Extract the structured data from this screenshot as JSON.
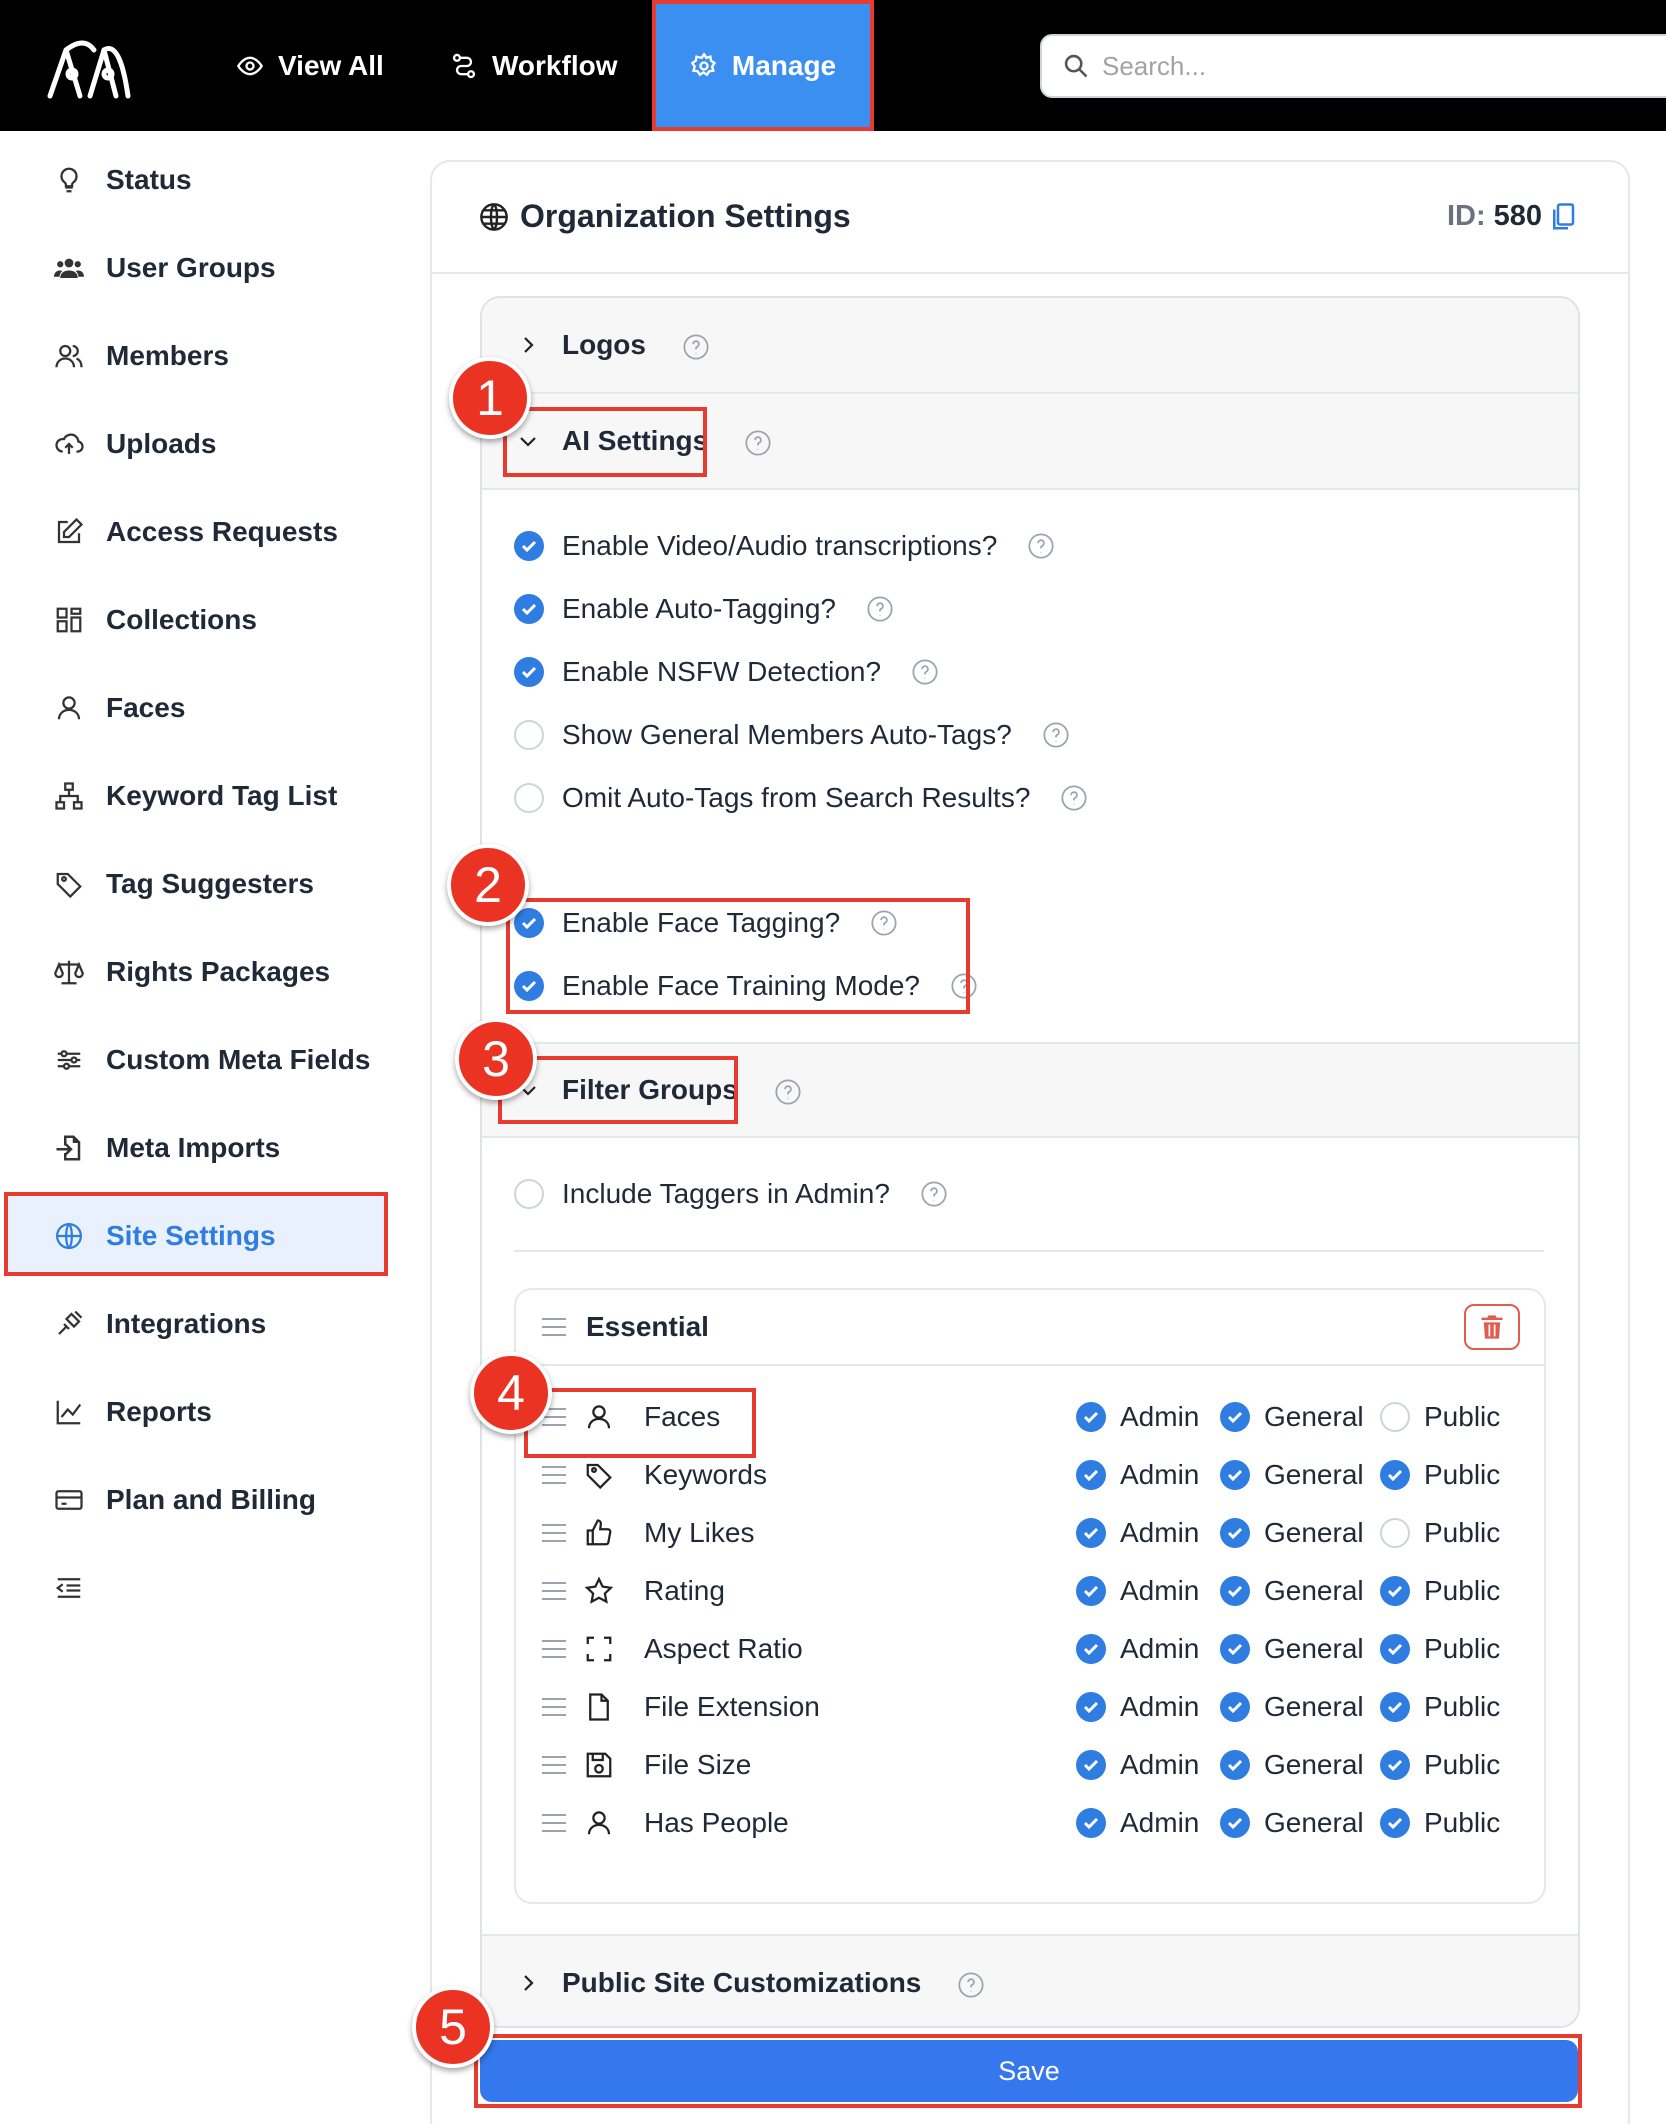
{
  "topbar": {
    "nav": [
      {
        "label": "View All",
        "icon": "eye-icon"
      },
      {
        "label": "Workflow",
        "icon": "workflow-icon"
      },
      {
        "label": "Manage",
        "icon": "gear-icon",
        "active": true
      }
    ],
    "search_placeholder": "Search..."
  },
  "sidebar": {
    "items": [
      {
        "label": "Status",
        "icon": "lightbulb-icon"
      },
      {
        "label": "User Groups",
        "icon": "users-icon"
      },
      {
        "label": "Members",
        "icon": "members-icon"
      },
      {
        "label": "Uploads",
        "icon": "cloud-upload-icon"
      },
      {
        "label": "Access Requests",
        "icon": "edit-icon"
      },
      {
        "label": "Collections",
        "icon": "collections-icon"
      },
      {
        "label": "Faces",
        "icon": "user-icon"
      },
      {
        "label": "Keyword Tag List",
        "icon": "sitemap-icon"
      },
      {
        "label": "Tag Suggesters",
        "icon": "tag-icon"
      },
      {
        "label": "Rights Packages",
        "icon": "scale-icon"
      },
      {
        "label": "Custom Meta Fields",
        "icon": "sliders-icon"
      },
      {
        "label": "Meta Imports",
        "icon": "file-import-icon"
      },
      {
        "label": "Site Settings",
        "icon": "globe-icon",
        "active": true
      },
      {
        "label": "Integrations",
        "icon": "plug-icon"
      },
      {
        "label": "Reports",
        "icon": "chart-line-icon"
      },
      {
        "label": "Plan and Billing",
        "icon": "credit-card-icon"
      }
    ],
    "collapse_icon": "collapse-menu-icon"
  },
  "card": {
    "title": "Organization Settings",
    "id_label": "ID:",
    "id_value": "580"
  },
  "sections": {
    "logos": "Logos",
    "ai_settings": "AI Settings",
    "filter_groups": "Filter Groups",
    "public_site": "Public Site Customizations"
  },
  "ai_options": [
    {
      "label": "Enable Video/Audio transcriptions?",
      "checked": true
    },
    {
      "label": "Enable Auto-Tagging?",
      "checked": true
    },
    {
      "label": "Enable NSFW Detection?",
      "checked": true
    },
    {
      "label": "Show General Members Auto-Tags?",
      "checked": false
    },
    {
      "label": "Omit Auto-Tags from Search Results?",
      "checked": false
    },
    {
      "label": "Enable Face Tagging?",
      "checked": true
    },
    {
      "label": "Enable Face Training Mode?",
      "checked": true
    }
  ],
  "filter_groups": {
    "include_taggers": {
      "label": "Include Taggers in Admin?",
      "checked": false
    },
    "group_name": "Essential",
    "perm_labels": {
      "admin": "Admin",
      "general": "General",
      "public": "Public"
    },
    "filters": [
      {
        "name": "Faces",
        "icon": "user-icon",
        "admin": true,
        "general": true,
        "public": false
      },
      {
        "name": "Keywords",
        "icon": "tag-icon",
        "admin": true,
        "general": true,
        "public": true
      },
      {
        "name": "My Likes",
        "icon": "thumbs-up-icon",
        "admin": true,
        "general": true,
        "public": false
      },
      {
        "name": "Rating",
        "icon": "star-icon",
        "admin": true,
        "general": true,
        "public": true
      },
      {
        "name": "Aspect Ratio",
        "icon": "crop-icon",
        "admin": true,
        "general": true,
        "public": true
      },
      {
        "name": "File Extension",
        "icon": "file-icon",
        "admin": true,
        "general": true,
        "public": true
      },
      {
        "name": "File Size",
        "icon": "floppy-icon",
        "admin": true,
        "general": true,
        "public": true
      },
      {
        "name": "Has People",
        "icon": "user-icon",
        "admin": true,
        "general": true,
        "public": true
      }
    ]
  },
  "save_label": "Save",
  "annotations": [
    "1",
    "2",
    "3",
    "4",
    "5"
  ],
  "colors": {
    "accent": "#2f7de1",
    "manage_bg": "#3b8ff0",
    "annotation": "#ea3323",
    "save_bg": "#3578ee"
  }
}
